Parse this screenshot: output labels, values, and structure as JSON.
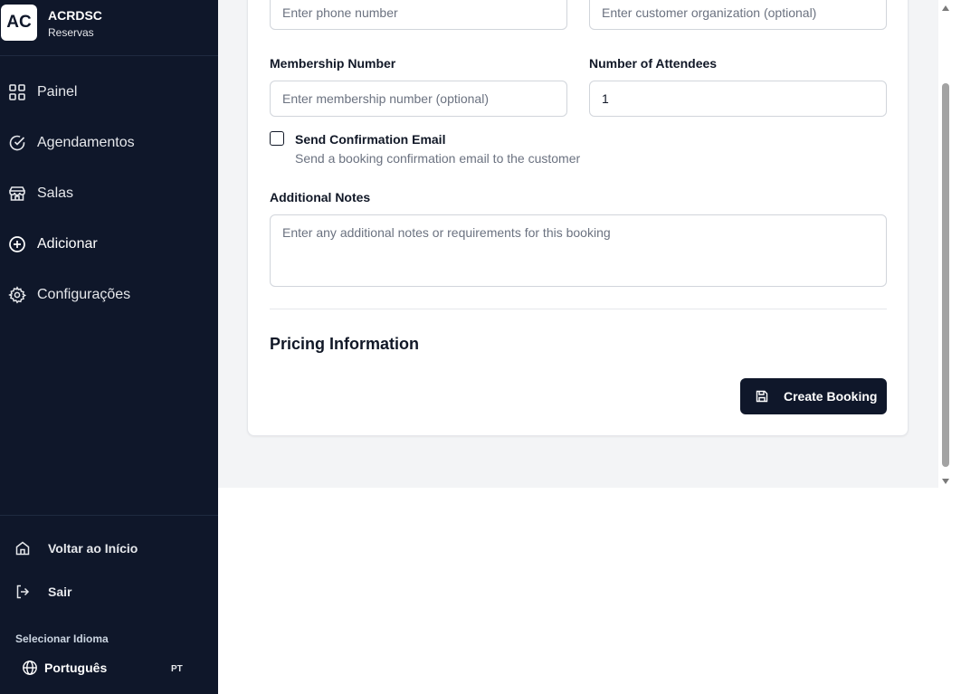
{
  "brand": {
    "logo": "AC",
    "name": "ACRDSC",
    "subtitle": "Reservas"
  },
  "sidebar": {
    "items": [
      {
        "label": "Painel",
        "icon": "grid-icon"
      },
      {
        "label": "Agendamentos",
        "icon": "check-circle-icon"
      },
      {
        "label": "Salas",
        "icon": "store-icon"
      },
      {
        "label": "Adicionar",
        "icon": "plus-circle-icon"
      },
      {
        "label": "Configurações",
        "icon": "gear-icon"
      }
    ],
    "footer": {
      "home": "Voltar ao Início",
      "logout": "Sair",
      "language_heading": "Selecionar Idioma",
      "language": "Português",
      "language_code": "PT"
    }
  },
  "form": {
    "phone_placeholder": "Enter phone number",
    "organization_placeholder": "Enter customer organization (optional)",
    "membership_label": "Membership Number",
    "membership_placeholder": "Enter membership number (optional)",
    "attendees_label": "Number of Attendees",
    "attendees_value": "1",
    "confirmation_label": "Send Confirmation Email",
    "confirmation_desc": "Send a booking confirmation email to the customer",
    "confirmation_checked": false,
    "notes_label": "Additional Notes",
    "notes_placeholder": "Enter any additional notes or requirements for this booking",
    "pricing_title": "Pricing Information",
    "submit_label": "Create Booking"
  },
  "colors": {
    "sidebar_bg": "#0f172a",
    "content_bg": "#f3f4f6",
    "primary_button": "#0f172a"
  }
}
